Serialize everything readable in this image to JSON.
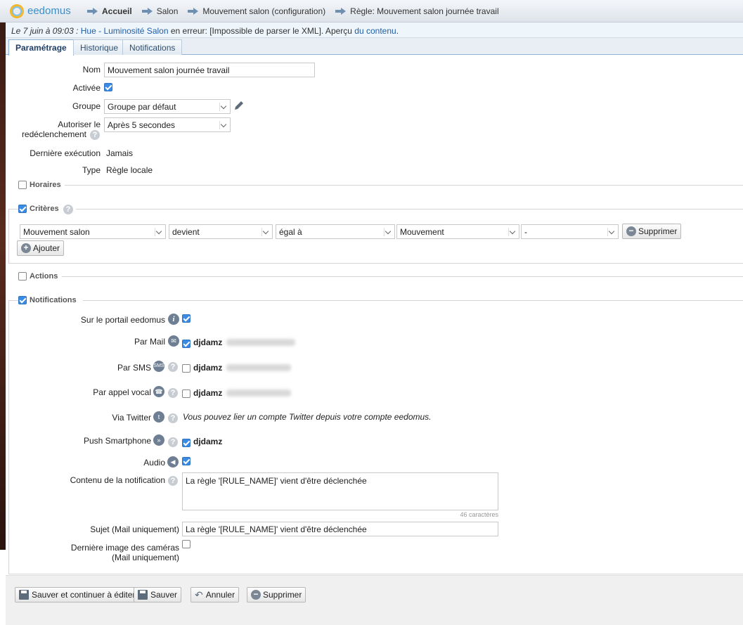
{
  "app": {
    "name": "eedomus"
  },
  "breadcrumb": [
    "Accueil",
    "Salon",
    "Mouvement salon (configuration)",
    "Règle: Mouvement salon journée travail"
  ],
  "notification_bar": {
    "date": "Le 7 juin à 09:03 :",
    "device": "Hue - Luminosité Salon",
    "message": " en erreur: [Impossible de parser le XML]. Aperçu ",
    "link": "du contenu",
    "end": "."
  },
  "tabs": [
    "Paramétrage",
    "Historique",
    "Notifications"
  ],
  "form": {
    "nom_label": "Nom",
    "nom_value": "Mouvement salon journée travail",
    "activee_label": "Activée",
    "activee_checked": true,
    "groupe_label": "Groupe",
    "groupe_value": "Groupe par défaut",
    "redeclenchement_label_1": "Autoriser le",
    "redeclenchement_label_2": "redéclenchement",
    "redeclenchement_value": "Après 5 secondes",
    "derniere_label": "Dernière exécution",
    "derniere_value": "Jamais",
    "type_label": "Type",
    "type_value": "Règle locale"
  },
  "sections": {
    "horaires": {
      "label": "Horaires",
      "checked": false
    },
    "criteres": {
      "label": "Critères",
      "checked": true
    },
    "actions": {
      "label": "Actions",
      "checked": false
    },
    "notifications": {
      "label": "Notifications",
      "checked": true
    }
  },
  "criterion": {
    "device": "Mouvement salon",
    "verb": "devient",
    "operator": "égal à",
    "value": "Mouvement",
    "extra": "-",
    "delete_label": "Supprimer",
    "add_label": "Ajouter"
  },
  "notifs": {
    "portail_label": "Sur le portail eedomus",
    "portail_checked": true,
    "mail_label": "Par Mail",
    "mail_checked": true,
    "mail_user": "djdamz",
    "sms_label": "Par SMS",
    "sms_icon_text": "SMS",
    "sms_checked": false,
    "sms_user": "djdamz",
    "appel_label": "Par appel vocal",
    "appel_checked": false,
    "appel_user": "djdamz",
    "twitter_label": "Via Twitter",
    "twitter_note": "Vous pouvez lier un compte Twitter depuis votre compte eedomus.",
    "push_label": "Push Smartphone",
    "push_checked": true,
    "push_user": "djdamz",
    "audio_label": "Audio",
    "audio_checked": true,
    "contenu_label": "Contenu de la notification",
    "contenu_value": "La règle '[RULE_NAME]' vient d'être déclenchée",
    "contenu_count": "46 caractères",
    "sujet_label": "Sujet (Mail uniquement)",
    "sujet_value": "La règle '[RULE_NAME]' vient d'être déclenchée",
    "camera_label_1": "Dernière image des caméras",
    "camera_label_2": "(Mail uniquement)",
    "camera_checked": false
  },
  "buttons": {
    "save_continue": "Sauver et continuer à éditer",
    "save": "Sauver",
    "cancel": "Annuler",
    "delete": "Supprimer"
  },
  "colors": {
    "accent": "#3b8be5",
    "link": "#1f5ea8",
    "tab_border": "#8fb3d4"
  }
}
